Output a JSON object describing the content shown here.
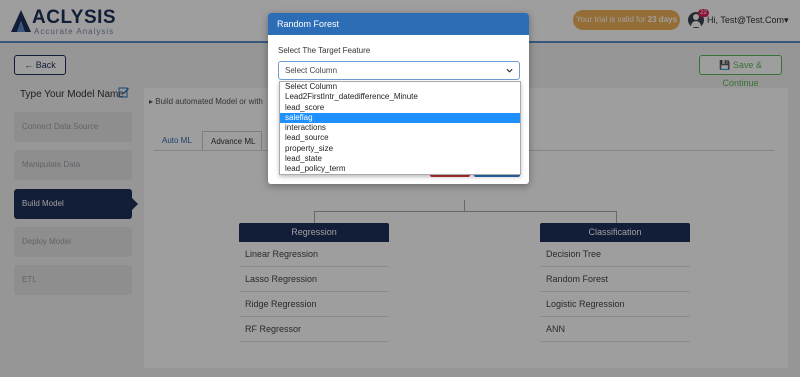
{
  "header": {
    "brand_name": "ACLYSIS",
    "brand_tagline": "Accurate Analysis",
    "trial_prefix": "Your trial is valid for ",
    "trial_days": "23 days",
    "notification_count": "22",
    "user_label": "Hi, Test@Test.Com"
  },
  "nav": {
    "back_label": "Back",
    "save_label": "Save & Continue"
  },
  "sidebar": {
    "model_name_placeholder": "Type Your Model Name",
    "steps": [
      {
        "label": "Connect Data Source"
      },
      {
        "label": "Manipulate Data"
      },
      {
        "label": "Build Model"
      },
      {
        "label": "Deploy Model"
      },
      {
        "label": "ETL"
      }
    ]
  },
  "main": {
    "automate_text": "Build automated Model or with",
    "tabs": [
      {
        "label": "Auto ML"
      },
      {
        "label": "Advance ML"
      }
    ]
  },
  "groups": {
    "regression": {
      "title": "Regression",
      "items": [
        "Linear Regression",
        "Lasso Regression",
        "Ridge Regression",
        "RF Regressor"
      ]
    },
    "classification": {
      "title": "Classification",
      "items": [
        "Decision Tree",
        "Random Forest",
        "Logistic Regression",
        "ANN"
      ]
    }
  },
  "modal": {
    "title": "Random Forest",
    "label": "Select The Target Feature",
    "select_value": "Select Column",
    "options": [
      "Select Column",
      "Lead2FirstIntr_datedifference_Minute",
      "lead_score",
      "saleflag",
      "interactions",
      "lead_source",
      "property_size",
      "lead_state",
      "lead_policy_term"
    ],
    "highlighted_option": "saleflag"
  },
  "colors": {
    "brand_navy": "#1e2f5a",
    "modal_header": "#2c6db5",
    "trial_badge": "#f0b25a",
    "save_green": "#5cb85c",
    "highlight": "#1e90ff"
  }
}
